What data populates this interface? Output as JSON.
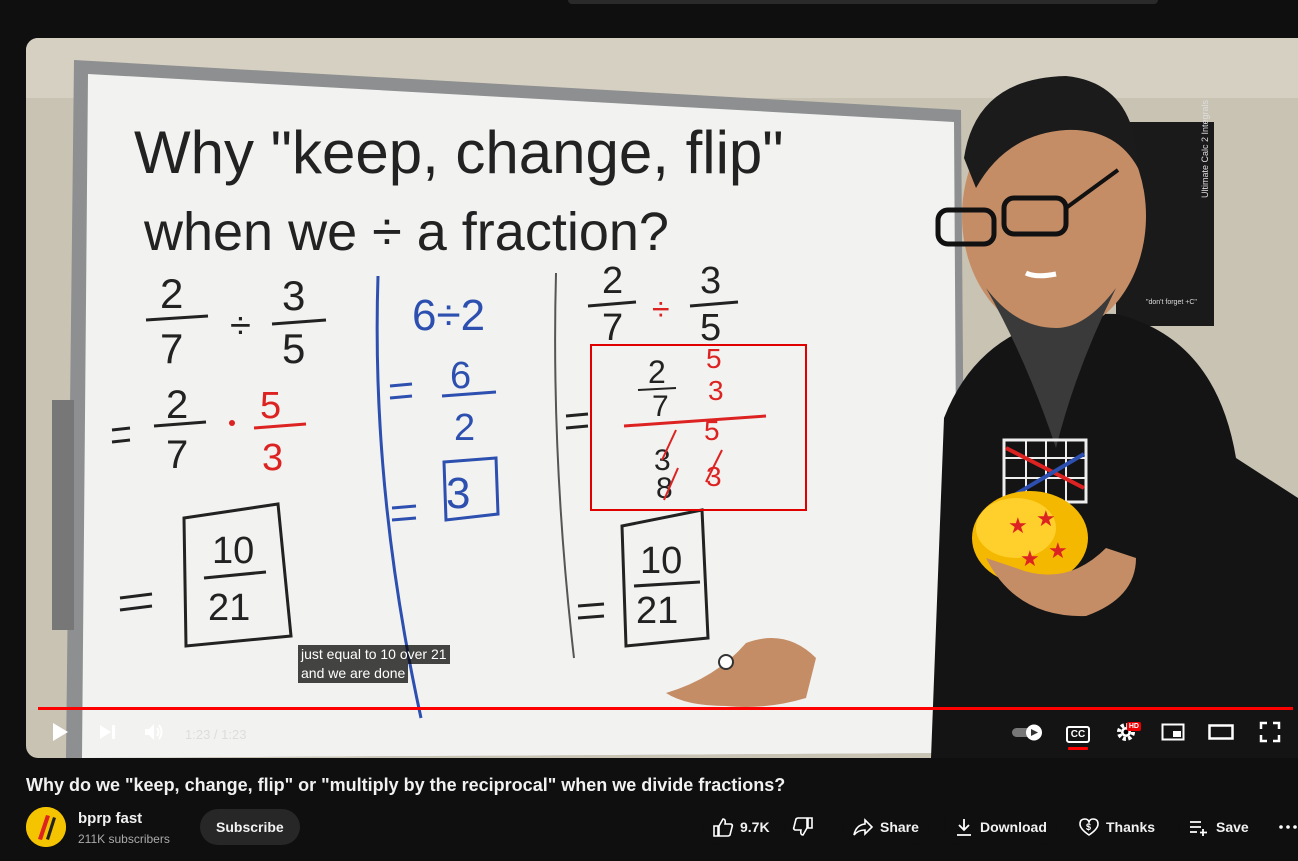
{
  "video": {
    "captions": [
      "just equal to 10 over 21",
      "and we are done"
    ],
    "time_current": "1:23",
    "time_separator": " / ",
    "time_total": "1:23",
    "progress": 1.0,
    "whiteboard": {
      "title_line1": "Why \"keep, change, flip\"",
      "title_line2": "when we ÷ a fraction?",
      "poster_text": "Ultimate Calc 2 Integrals",
      "poster_note": "\"don't forget +C\""
    }
  },
  "controls": {
    "play_icon": "play-icon",
    "next_icon": "next-icon",
    "volume_icon": "volume-icon",
    "autoplay_icon": "autoplay-toggle-icon",
    "cc_label": "CC",
    "hd_badge": "HD",
    "settings_icon": "gear-icon",
    "miniplayer_icon": "miniplayer-icon",
    "theater_icon": "theater-icon",
    "fullscreen_icon": "fullscreen-icon"
  },
  "title": "Why do we \"keep, change, flip\" or \"multiply by the reciprocal\" when we divide fractions?",
  "channel": {
    "name": "bprp fast",
    "subscribers": "211K subscribers",
    "subscribe_label": "Subscribe"
  },
  "actions": {
    "like_count": "9.7K",
    "share_label": "Share",
    "download_label": "Download",
    "thanks_label": "Thanks",
    "save_label": "Save"
  },
  "colors": {
    "accent": "#ff0000",
    "background": "#0f0f0f",
    "button_bg": "#272727"
  }
}
